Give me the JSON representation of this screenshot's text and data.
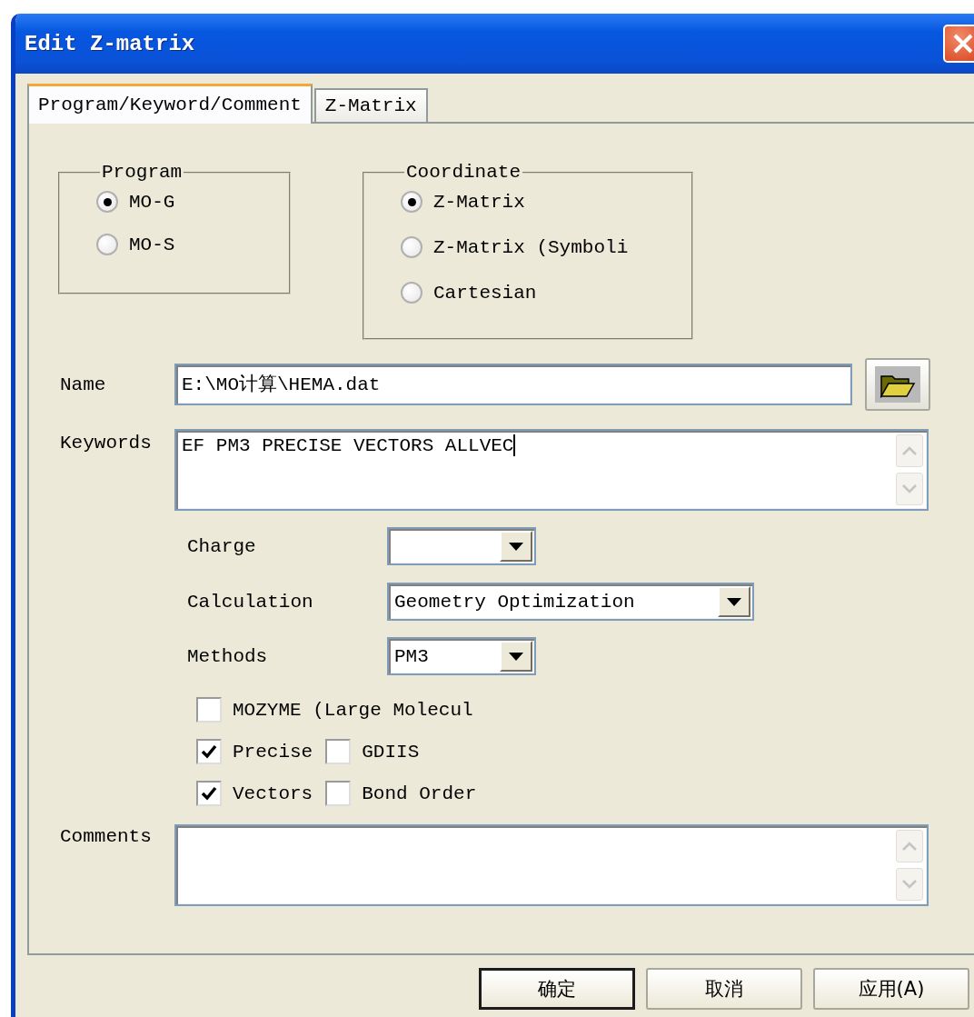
{
  "window": {
    "title": "Edit Z-matrix"
  },
  "tabs": [
    {
      "label": "Program/Keyword/Comment",
      "selected": true
    },
    {
      "label": "Z-Matrix",
      "selected": false
    }
  ],
  "program": {
    "title": "Program",
    "options": [
      {
        "label": "MO-G",
        "selected": true
      },
      {
        "label": "MO-S",
        "selected": false
      }
    ]
  },
  "coordinate": {
    "title": "Coordinate",
    "options": [
      {
        "label": "Z-Matrix",
        "selected": true
      },
      {
        "label": "Z-Matrix (Symboli",
        "selected": false
      },
      {
        "label": "Cartesian",
        "selected": false
      }
    ]
  },
  "name": {
    "label": "Name",
    "value": "E:\\MO计算\\HEMA.dat"
  },
  "keywords": {
    "label": "Keywords",
    "value": "EF PM3 PRECISE VECTORS ALLVEC"
  },
  "charge": {
    "label": "Charge"
  },
  "calculation": {
    "label": "Calculation",
    "value": "Geometry Optimization"
  },
  "methods": {
    "label": "Methods",
    "value": "PM3"
  },
  "option_rows": [
    {
      "items": [
        {
          "label": "MOZYME (Large Molecul",
          "checked": false
        }
      ]
    },
    {
      "items": [
        {
          "label": "Precise",
          "checked": true
        },
        {
          "label": "GDIIS",
          "checked": false
        }
      ]
    },
    {
      "items": [
        {
          "label": "Vectors",
          "checked": true
        },
        {
          "label": "Bond Order",
          "checked": false
        }
      ]
    }
  ],
  "comments": {
    "label": "Comments"
  },
  "buttons": [
    {
      "label": "确定",
      "default": true
    },
    {
      "label": "取消",
      "default": false
    },
    {
      "label": "应用(A)",
      "default": false
    }
  ]
}
